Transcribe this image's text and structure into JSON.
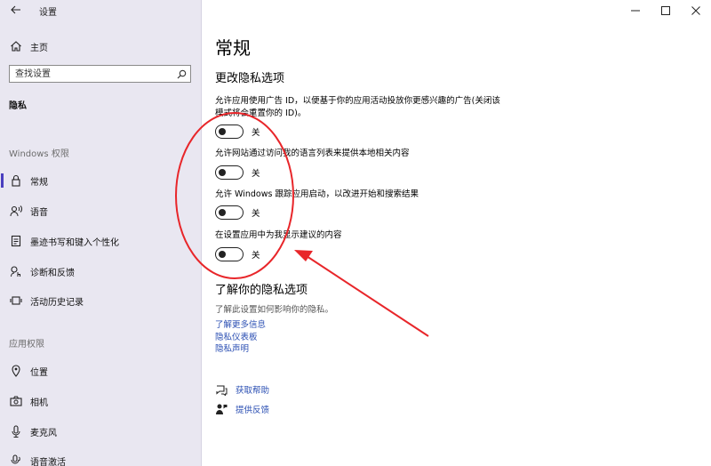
{
  "window": {
    "title": "设置",
    "accent_color": "#4a3fbf",
    "link_color": "#2b4fb3",
    "annotation_color": "#e8262a"
  },
  "sidebar": {
    "home_label": "主页",
    "search_placeholder": "查找设置",
    "section_title": "隐私",
    "groups": [
      {
        "title": "Windows 权限",
        "items": [
          {
            "label": "常规",
            "icon": "lock-icon",
            "selected": true
          },
          {
            "label": "语音",
            "icon": "speech-icon"
          },
          {
            "label": "墨迹书写和键入个性化",
            "icon": "notepad-icon"
          },
          {
            "label": "诊断和反馈",
            "icon": "diagnostics-icon"
          },
          {
            "label": "活动历史记录",
            "icon": "activity-history-icon"
          }
        ]
      },
      {
        "title": "应用权限",
        "items": [
          {
            "label": "位置",
            "icon": "location-icon"
          },
          {
            "label": "相机",
            "icon": "camera-icon"
          },
          {
            "label": "麦克风",
            "icon": "microphone-icon"
          },
          {
            "label": "语音激活",
            "icon": "voice-activation-icon"
          }
        ]
      }
    ]
  },
  "main": {
    "page_title": "常规",
    "section_title": "更改隐私选项",
    "options": [
      {
        "text": "允许应用使用广告 ID，以便基于你的应用活动投放你更感兴趣的广告(关闭该模式将会重置你的 ID)。",
        "state_label": "关",
        "on": false
      },
      {
        "text": "允许网站通过访问我的语言列表来提供本地相关内容",
        "state_label": "关",
        "on": false
      },
      {
        "text": "允许 Windows 跟踪应用启动，以改进开始和搜索结果",
        "state_label": "关",
        "on": false
      },
      {
        "text": "在设置应用中为我显示建议的内容",
        "state_label": "关",
        "on": false
      }
    ],
    "learn": {
      "title": "了解你的隐私选项",
      "description": "了解此设置如何影响你的隐私。",
      "links": [
        "了解更多信息",
        "隐私仪表板",
        "隐私声明"
      ]
    },
    "help": [
      {
        "label": "获取帮助",
        "icon": "help-chat-icon"
      },
      {
        "label": "提供反馈",
        "icon": "feedback-icon"
      }
    ]
  }
}
